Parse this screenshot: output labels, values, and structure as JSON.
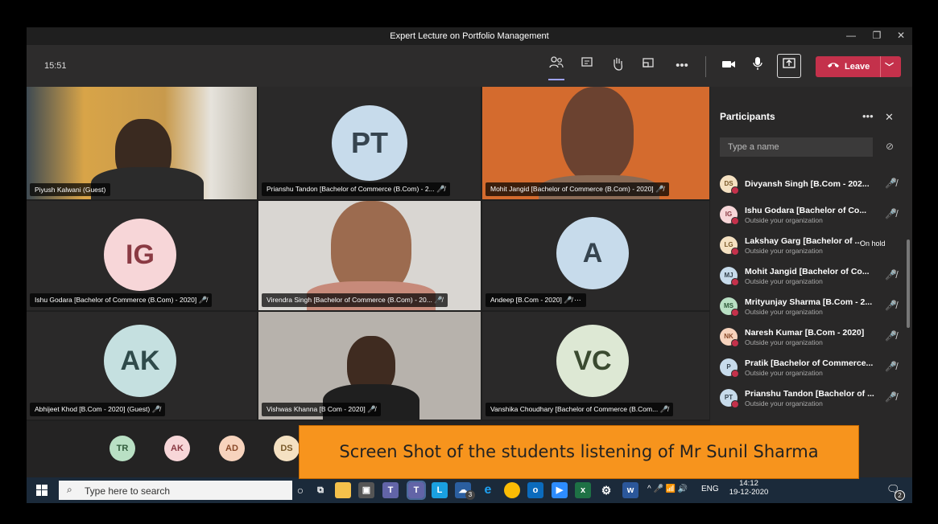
{
  "window": {
    "title": "Expert Lecture on Portfolio Management",
    "minimize": "—",
    "restore": "❐",
    "close": "✕"
  },
  "toolbar": {
    "clock": "15:51",
    "leave_label": "Leave"
  },
  "tiles": [
    {
      "label": "Piyush Kalwani (Guest)"
    },
    {
      "initials": "PT",
      "label": "Prianshu Tandon [Bachelor of Commerce (B.Com) - 2...",
      "mic": "🎤̸"
    },
    {
      "label": "Mohit Jangid [Bachelor of Commerce (B.Com) - 2020]",
      "mic": "🎤̸"
    },
    {
      "initials": "IG",
      "label": "Ishu Godara [Bachelor of Commerce (B.Com) - 2020]",
      "mic": "🎤̸"
    },
    {
      "label": "Virendra Singh [Bachelor of Commerce (B.Com) - 20...",
      "mic": "🎤̸"
    },
    {
      "initials": "A",
      "label": "Andeep [B.Com - 2020]",
      "mic": "🎤̸ ⋯"
    },
    {
      "initials": "AK",
      "label": "Abhijeet Khod [B.Com - 2020] (Guest)",
      "mic": "🎤̸"
    },
    {
      "label": "Vishwas Khanna [B Com - 2020]",
      "mic": "🎤̸"
    },
    {
      "initials": "VC",
      "label": "Vanshika Choudhary [Bachelor of Commerce (B.Com...",
      "mic": "🎤̸"
    }
  ],
  "bottom_avatars": [
    "TR",
    "AK",
    "AD",
    "DS"
  ],
  "participants": {
    "title": "Participants",
    "more": "•••",
    "close": "✕",
    "search_placeholder": "Type a name",
    "link_icon": "⊘",
    "list": [
      {
        "initials": "DS",
        "name": "Divyansh Singh [B.Com - 202...",
        "sub": "",
        "status": "🎤̸"
      },
      {
        "initials": "IG",
        "name": "Ishu Godara [Bachelor of Co...",
        "sub": "Outside your organization",
        "status": "🎤̸"
      },
      {
        "initials": "LG",
        "name": "Lakshay Garg [Bachelor of ...",
        "sub": "Outside your organization",
        "status": "On hold"
      },
      {
        "initials": "MJ",
        "name": "Mohit Jangid [Bachelor of Co...",
        "sub": "Outside your organization",
        "status": "🎤̸"
      },
      {
        "initials": "MS",
        "name": "Mrityunjay Sharma [B.Com - 2...",
        "sub": "Outside your organization",
        "status": "🎤̸"
      },
      {
        "initials": "NK",
        "name": "Naresh Kumar [B.Com - 2020]",
        "sub": "Outside your organization",
        "status": "🎤̸"
      },
      {
        "initials": "P",
        "name": "Pratik [Bachelor of Commerce...",
        "sub": "Outside your organization",
        "status": "🎤̸"
      },
      {
        "initials": "PT",
        "name": "Prianshu Tandon [Bachelor of ...",
        "sub": "Outside your organization",
        "status": "🎤̸"
      }
    ]
  },
  "overlay_caption": "Screen Shot of the students listening of Mr Sunil Sharma",
  "taskbar": {
    "search_placeholder": "Type here to search",
    "lang": "ENG",
    "time": "14:12",
    "date": "19-12-2020",
    "notif_count": "2",
    "badge": "3"
  },
  "colors": {
    "leave": "#c4314b",
    "overlay": "#f7941d",
    "panel": "#292828",
    "toolbar": "#2d2c2c"
  }
}
